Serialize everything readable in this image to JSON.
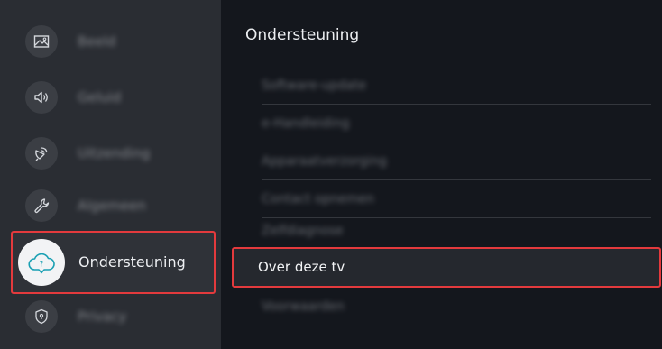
{
  "sidebar": {
    "items": [
      {
        "label": "Beeld",
        "icon": "picture-icon"
      },
      {
        "label": "Geluid",
        "icon": "sound-icon"
      },
      {
        "label": "Uitzending",
        "icon": "broadcast-icon"
      },
      {
        "label": "Algemeen",
        "icon": "wrench-icon"
      },
      {
        "label": "Ondersteuning",
        "icon": "support-cloud-icon",
        "selected": true
      },
      {
        "label": "Privacy",
        "icon": "shield-icon"
      }
    ]
  },
  "main": {
    "title": "Ondersteuning",
    "items": [
      {
        "label": "Software-update"
      },
      {
        "label": "e-Handleiding"
      },
      {
        "label": "Apparaatverzorging"
      },
      {
        "label": "Contact opnemen"
      },
      {
        "label": "Zelfdiagnose"
      },
      {
        "label": "Over deze tv",
        "selected": true
      },
      {
        "label": "Voorwaarden"
      }
    ]
  },
  "colors": {
    "sidebar_bg": "#2a2d33",
    "main_bg": "#14171d",
    "selection_border": "#e33a3d",
    "text": "#e9ebee"
  }
}
